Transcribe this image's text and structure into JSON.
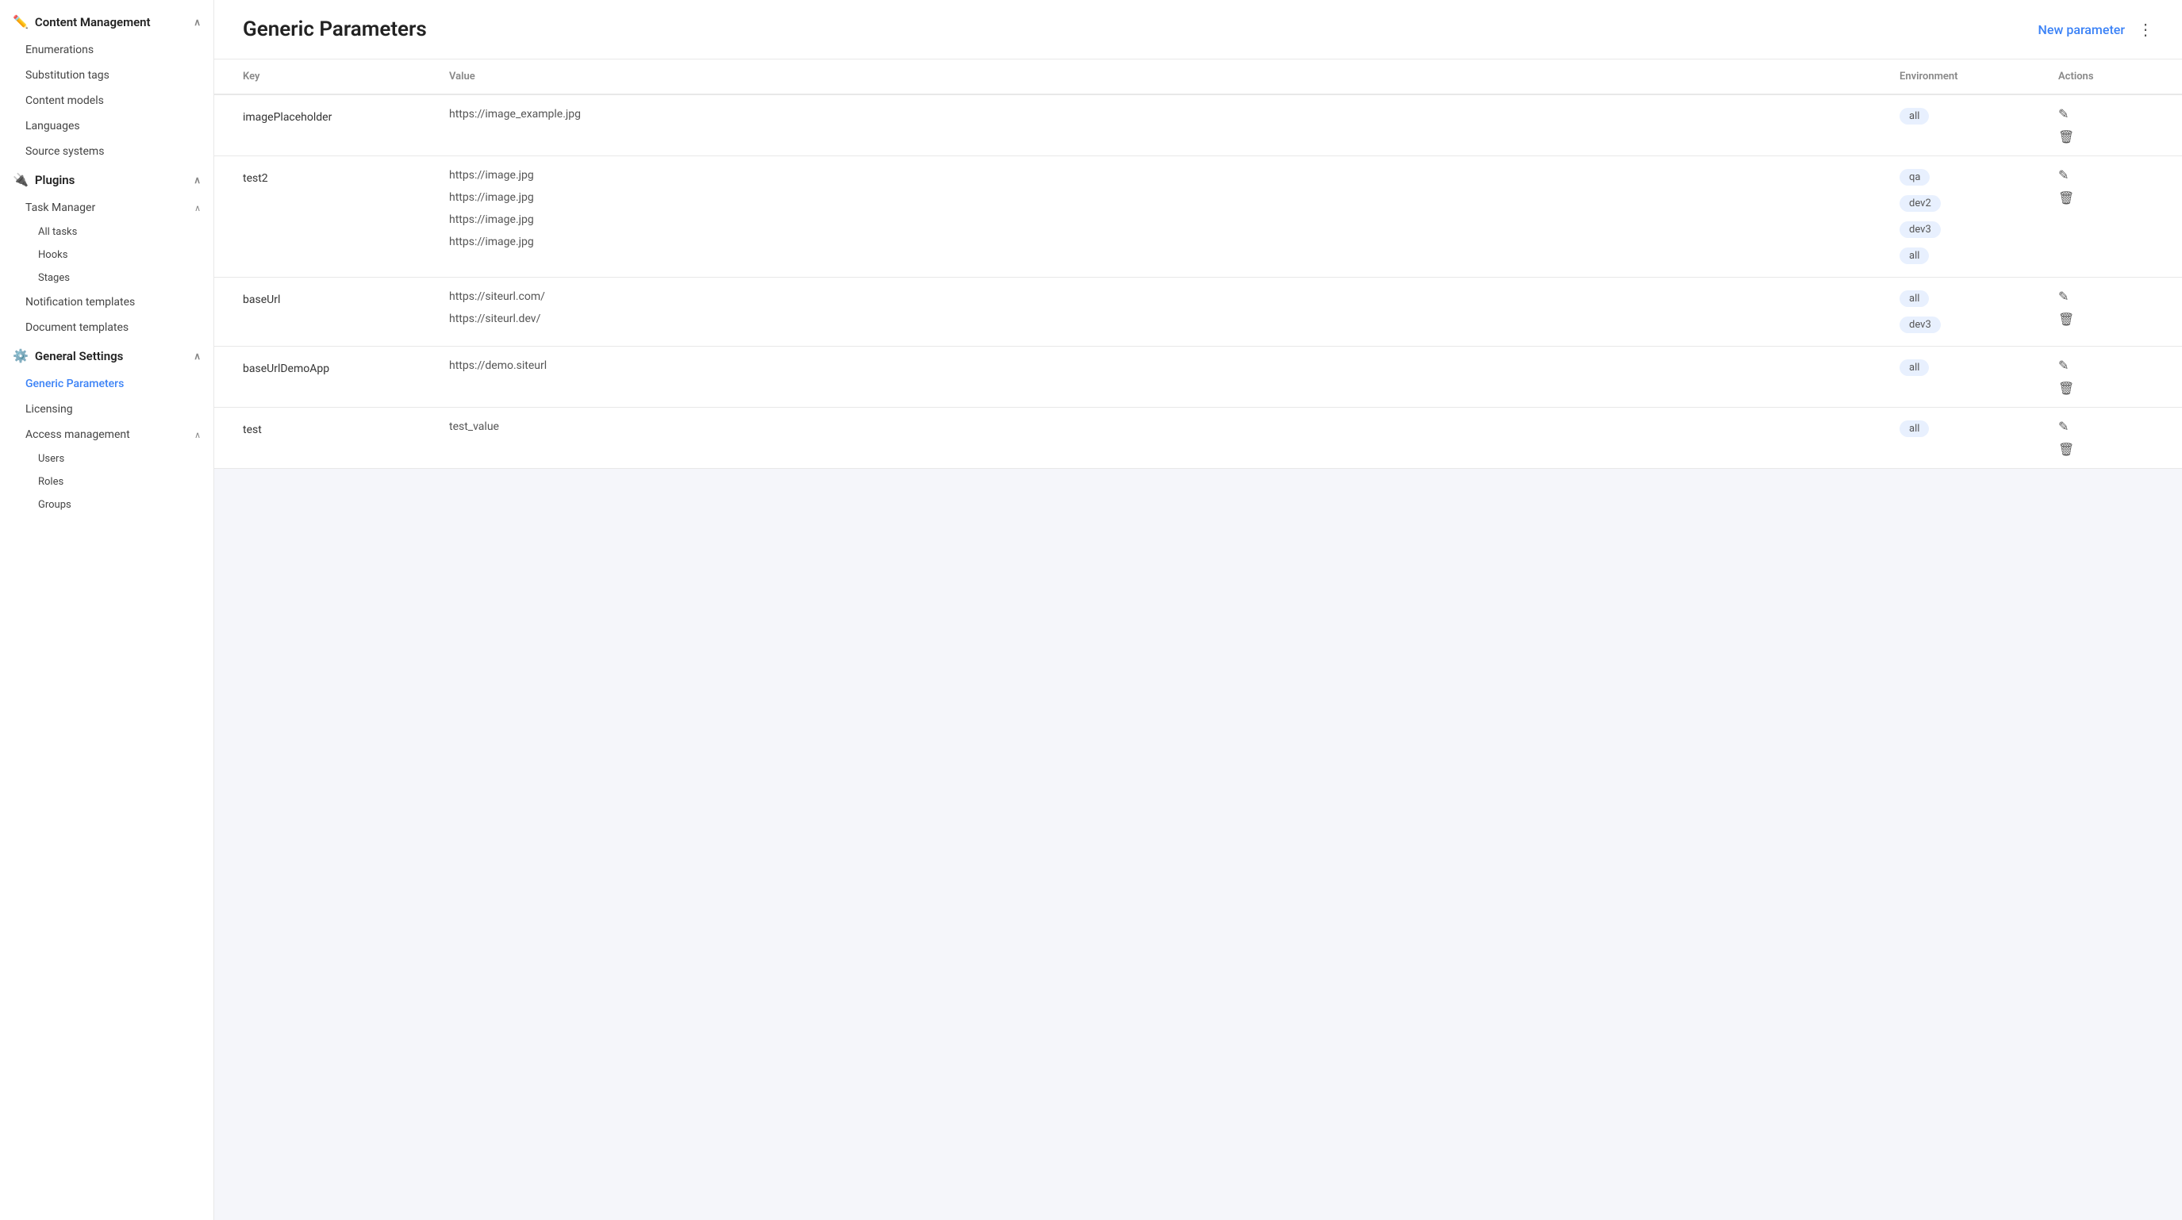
{
  "sidebar": {
    "sections": [
      {
        "id": "content-management",
        "label": "Content Management",
        "icon": "✏️",
        "expanded": true,
        "items": [
          {
            "id": "enumerations",
            "label": "Enumerations",
            "active": false
          },
          {
            "id": "substitution-tags",
            "label": "Substitution tags",
            "active": false
          },
          {
            "id": "content-models",
            "label": "Content models",
            "active": false
          },
          {
            "id": "languages",
            "label": "Languages",
            "active": false
          },
          {
            "id": "source-systems",
            "label": "Source systems",
            "active": false
          }
        ]
      },
      {
        "id": "plugins",
        "label": "Plugins",
        "icon": "🔌",
        "expanded": true,
        "items": [],
        "subsections": [
          {
            "id": "task-manager",
            "label": "Task Manager",
            "expanded": true,
            "items": [
              {
                "id": "all-tasks",
                "label": "All tasks",
                "active": false
              },
              {
                "id": "hooks",
                "label": "Hooks",
                "active": false
              },
              {
                "id": "stages",
                "label": "Stages",
                "active": false
              }
            ]
          }
        ],
        "extra_items": [
          {
            "id": "notification-templates",
            "label": "Notification templates",
            "active": false
          },
          {
            "id": "document-templates",
            "label": "Document templates",
            "active": false
          }
        ]
      },
      {
        "id": "general-settings",
        "label": "General Settings",
        "icon": "⚙️",
        "expanded": true,
        "items": [
          {
            "id": "generic-parameters",
            "label": "Generic Parameters",
            "active": true
          },
          {
            "id": "licensing",
            "label": "Licensing",
            "active": false
          }
        ],
        "subsections": [
          {
            "id": "access-management",
            "label": "Access management",
            "expanded": true,
            "items": [
              {
                "id": "users",
                "label": "Users",
                "active": false
              },
              {
                "id": "roles",
                "label": "Roles",
                "active": false
              },
              {
                "id": "groups",
                "label": "Groups",
                "active": false
              }
            ]
          }
        ]
      }
    ]
  },
  "page": {
    "title": "Generic Parameters",
    "new_param_label": "New parameter",
    "more_icon": "⋮"
  },
  "table": {
    "columns": [
      "Key",
      "Value",
      "Environment",
      "Actions"
    ],
    "rows": [
      {
        "key": "imagePlaceholder",
        "values": [
          "https://image_example.jpg"
        ],
        "environments": [
          "all"
        ]
      },
      {
        "key": "test2",
        "values": [
          "https://image.jpg",
          "https://image.jpg",
          "https://image.jpg",
          "https://image.jpg"
        ],
        "environments": [
          "qa",
          "dev2",
          "dev3",
          "all"
        ]
      },
      {
        "key": "baseUrl",
        "values": [
          "https://siteurl.com/",
          "https://siteurl.dev/"
        ],
        "environments": [
          "all",
          "dev3"
        ]
      },
      {
        "key": "baseUrlDemoApp",
        "values": [
          "https://demo.siteurl"
        ],
        "environments": [
          "all"
        ]
      },
      {
        "key": "test",
        "values": [
          "test_value"
        ],
        "environments": [
          "all"
        ]
      }
    ]
  },
  "icons": {
    "edit": "✎",
    "delete": "🗑",
    "chevron_up": "∧",
    "chevron_down": "∨"
  }
}
